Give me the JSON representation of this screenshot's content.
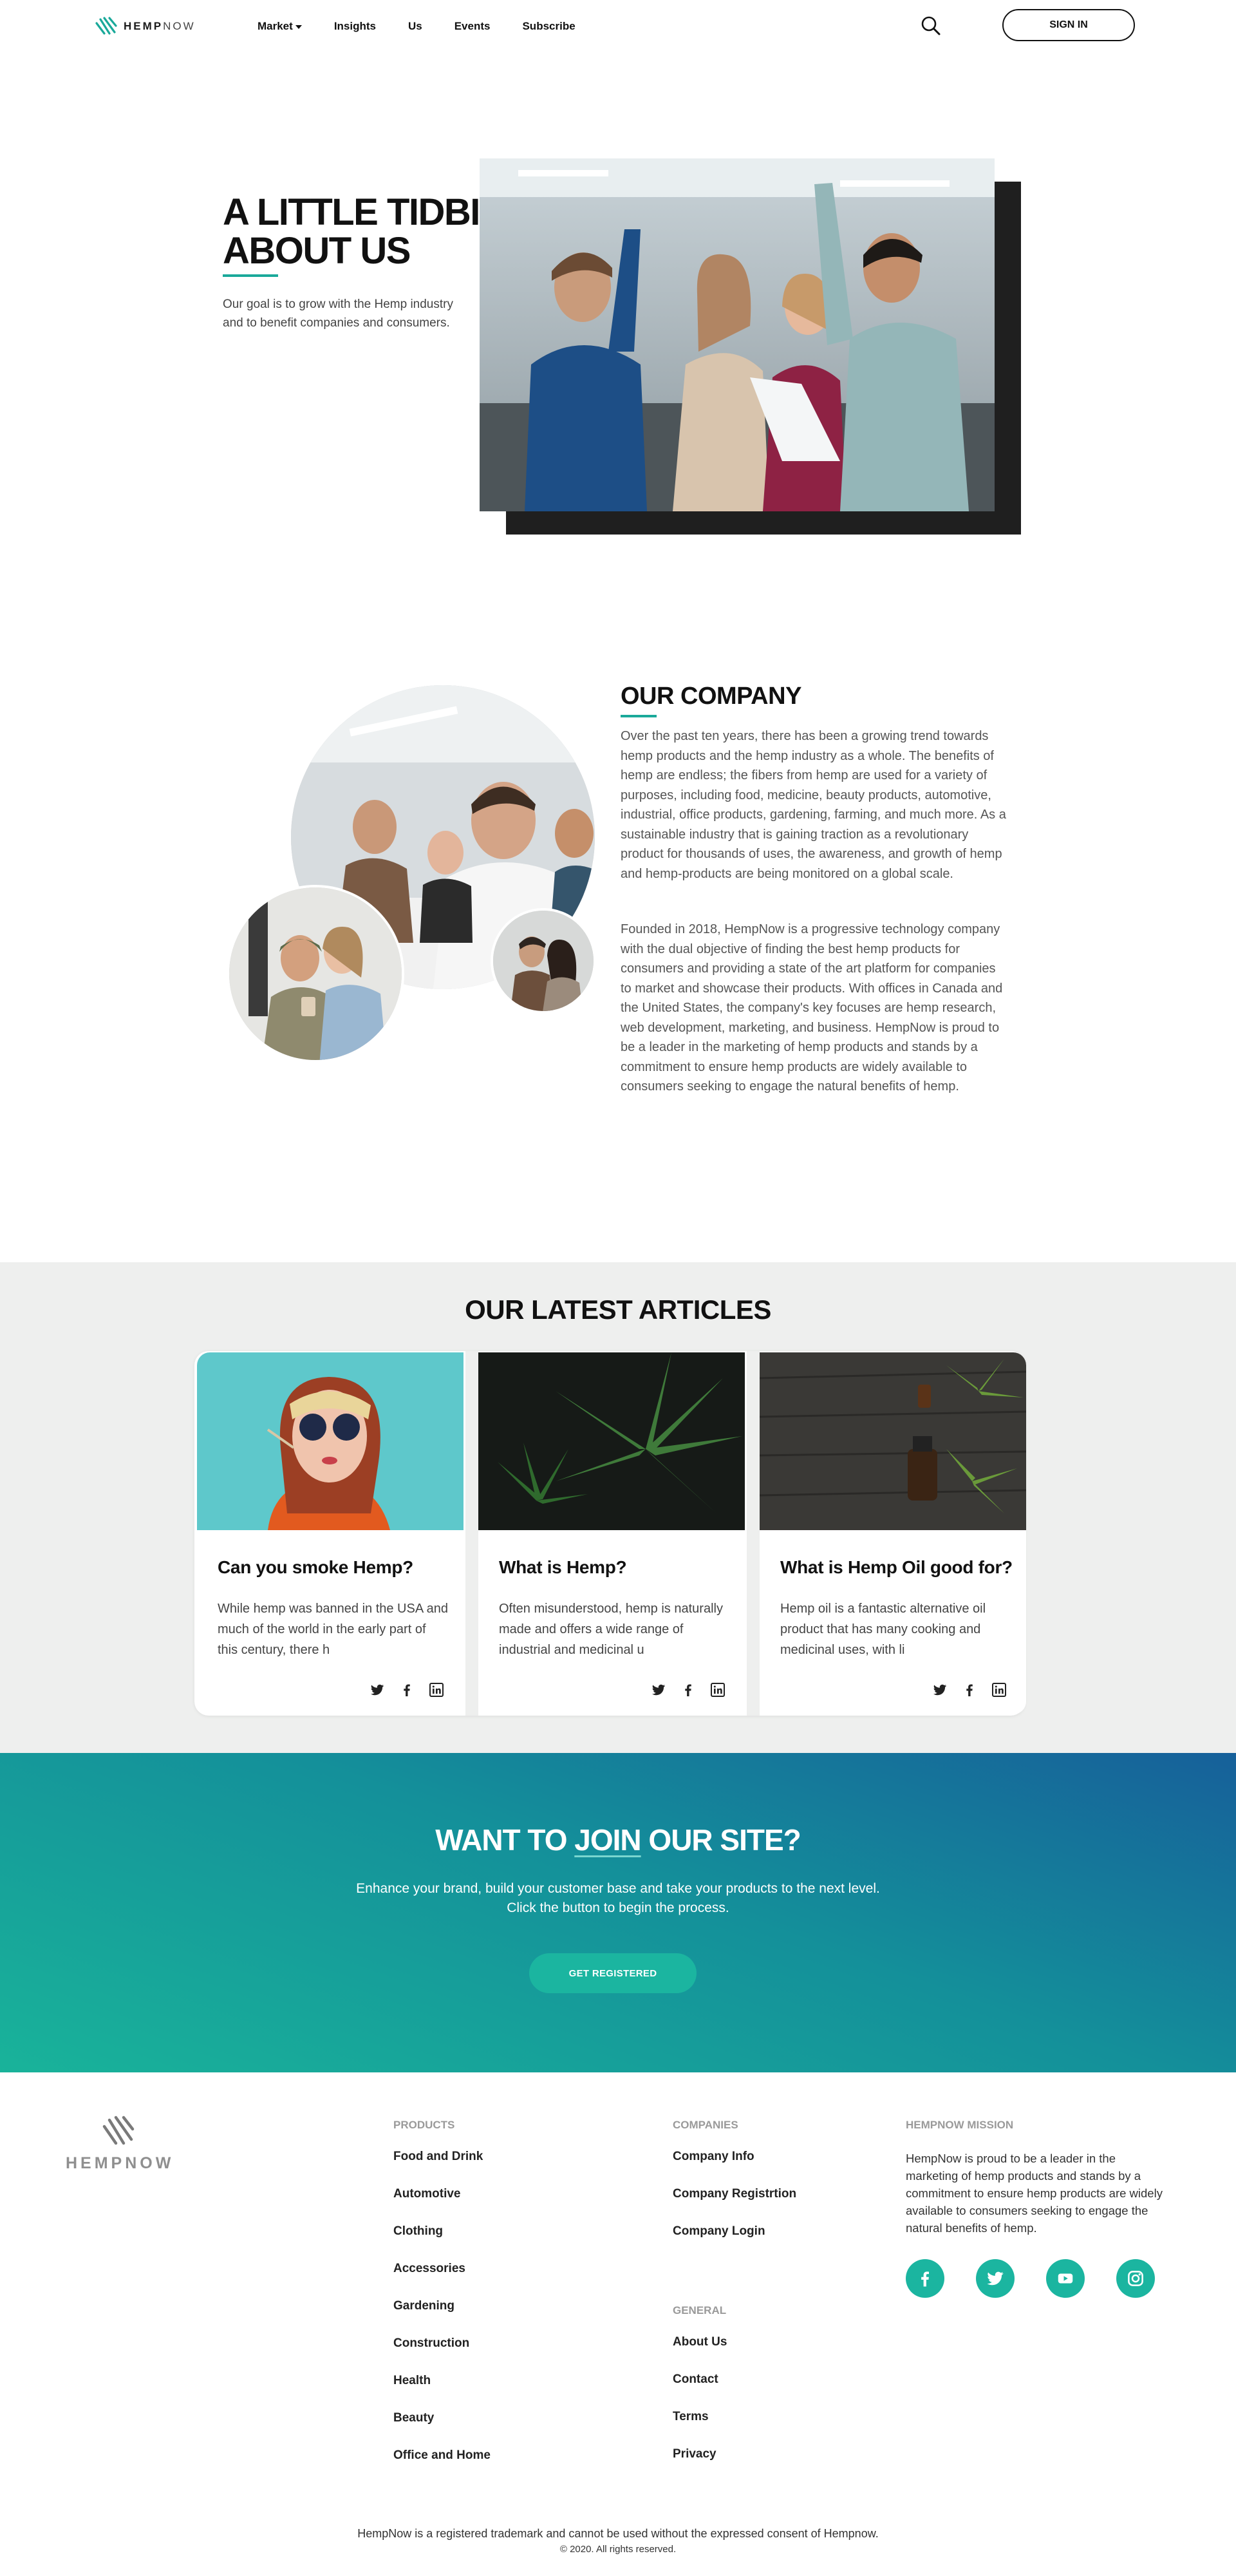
{
  "header": {
    "logo": {
      "bold": "HEMP",
      "thin": "NOW"
    },
    "nav": [
      {
        "label": "Market",
        "has_dropdown": true
      },
      {
        "label": "Insights"
      },
      {
        "label": "Us"
      },
      {
        "label": "Events"
      },
      {
        "label": "Subscribe"
      }
    ],
    "search_icon": "search-icon",
    "signin_label": "SIGN IN"
  },
  "about": {
    "title_line1": "A LITTLE TIDBIT",
    "title_line2": "ABOUT US",
    "text": "Our goal is to grow with the Hemp industry and to benefit companies and consumers."
  },
  "company": {
    "title": "OUR COMPANY",
    "p1": "Over the past ten years, there has been a growing trend towards hemp products and the hemp industry as a whole. The benefits of hemp are endless; the fibers from hemp are used for a variety of purposes, including food, medicine, beauty products, automotive, industrial, office products, gardening, farming, and much more. As a sustainable industry that is gaining traction as a revolutionary product for thousands of uses, the awareness, and growth of hemp and hemp-products are being monitored on a global scale.",
    "p2": "Founded in 2018, HempNow is a progressive technology company with the dual objective of finding the best hemp products for consumers and providing a state of the art platform for companies to market and showcase their products. With offices in Canada and the United States, the company's key focuses are hemp research, web development, marketing, and business. HempNow is proud to be a leader in the marketing of hemp products and stands by a commitment to ensure hemp products are widely available to consumers seeking to engage the natural benefits of hemp."
  },
  "articles": {
    "title": "OUR LATEST ARTICLES",
    "items": [
      {
        "title": "Can you smoke Hemp?",
        "excerpt": "While hemp was banned in the USA and much of the world in the early part of this century, there h"
      },
      {
        "title": "What is Hemp?",
        "excerpt": "Often misunderstood, hemp is naturally made and offers a wide range of industrial and medicinal u"
      },
      {
        "title": "What is Hemp Oil good for?",
        "excerpt": "Hemp oil is a fantastic alternative oil product that has many cooking and medicinal uses, with li"
      }
    ],
    "share_icons": [
      "twitter-icon",
      "facebook-icon",
      "linkedin-icon"
    ]
  },
  "join": {
    "title_pre": "WANT TO ",
    "title_join": "JOIN",
    "title_post": " OUR SITE?",
    "sub1": "Enhance your brand, build your customer base and take your products to the next level.",
    "sub2": "Click the button to begin the process.",
    "button": "GET REGISTERED"
  },
  "footer": {
    "logo_text": "HEMPNOW",
    "products_head": "PRODUCTS",
    "products": [
      "Food and Drink",
      "Automotive",
      "Clothing",
      "Accessories",
      "Gardening",
      "Construction",
      "Health",
      "Beauty",
      "Office and Home"
    ],
    "companies_head": "COMPANIES",
    "companies": [
      "Company Info",
      "Company Registrtion",
      "Company Login"
    ],
    "general_head": "GENERAL",
    "general": [
      "About Us",
      "Contact",
      "Terms",
      "Privacy"
    ],
    "mission_head": "HEMPNOW MISSION",
    "mission_text": "HempNow is proud to be a leader in the marketing of hemp products and stands by a commitment to ensure hemp products are widely available to consumers seeking to engage the natural benefits of hemp.",
    "social_icons": [
      "facebook-icon",
      "twitter-icon",
      "youtube-icon",
      "instagram-icon"
    ],
    "copyright1": "HempNow is a registered trademark and cannot be used without the expressed consent of Hempnow.",
    "copyright2": "© 2020. All rights reserved."
  },
  "colors": {
    "accent": "#1aa99a",
    "join_gradient_top": "#16609a",
    "join_gradient_bottom": "#19b39a",
    "articles_bg": "#eeefee"
  }
}
